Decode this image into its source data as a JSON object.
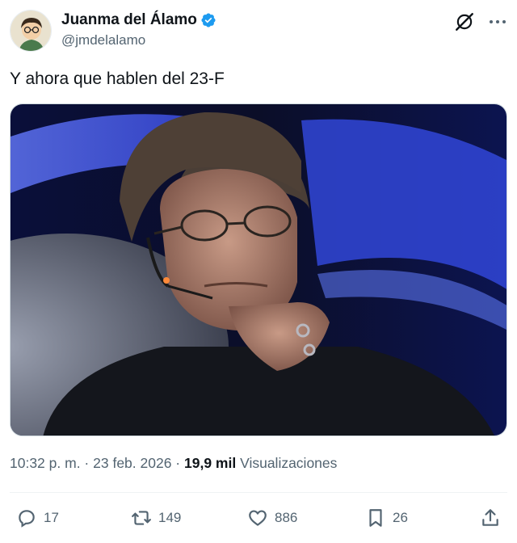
{
  "author": {
    "display_name": "Juanma del Álamo",
    "handle": "@jmdelalamo",
    "verified": true
  },
  "tweet": {
    "text": "Y ahora que hablen del 23-F"
  },
  "meta": {
    "time": "10:32 p. m.",
    "separator1": " · ",
    "date": "23 feb. 2026",
    "separator2": " · ",
    "views_count": "19,9 mil",
    "views_label": "Visualizaciones"
  },
  "actions": {
    "replies": "17",
    "reposts": "149",
    "likes": "886",
    "bookmarks": "26"
  },
  "icons": [
    "verified-badge-icon",
    "grok-icon",
    "more-icon",
    "reply-icon",
    "repost-icon",
    "like-icon",
    "bookmark-icon",
    "share-icon"
  ],
  "colors": {
    "verified": "#1d9bf0",
    "secondary_text": "#536471",
    "primary_text": "#0f1419"
  }
}
